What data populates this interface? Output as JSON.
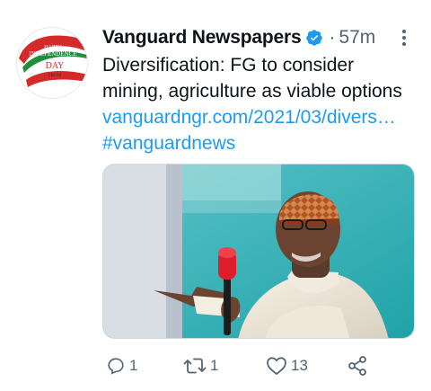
{
  "tweet": {
    "author": "Vanguard Newspapers",
    "separator": "·",
    "time": "57m",
    "text_line1": "Diversification: FG to consider",
    "text_line2": "mining, agriculture as viable options",
    "link": "vanguardngr.com/2021/03/divers…",
    "hashtag": "#vanguardnews"
  },
  "avatar": {
    "line1": "HAPPY",
    "line2": "INDEPENDENCE",
    "line3": "DAY",
    "line4": "FROM",
    "brand": "Vanguard"
  },
  "actions": {
    "reply_count": "1",
    "retweet_count": "1",
    "like_count": "13"
  },
  "icons": {
    "verified": "verified-badge-icon",
    "more": "more-icon",
    "reply": "reply-icon",
    "retweet": "retweet-icon",
    "like": "like-icon",
    "share": "share-icon"
  },
  "colors": {
    "link": "#1d9bf0",
    "verified": "#1d9bf0",
    "muted": "#536471",
    "avatar_red": "#d42a2a",
    "avatar_green": "#1f8f3a"
  }
}
